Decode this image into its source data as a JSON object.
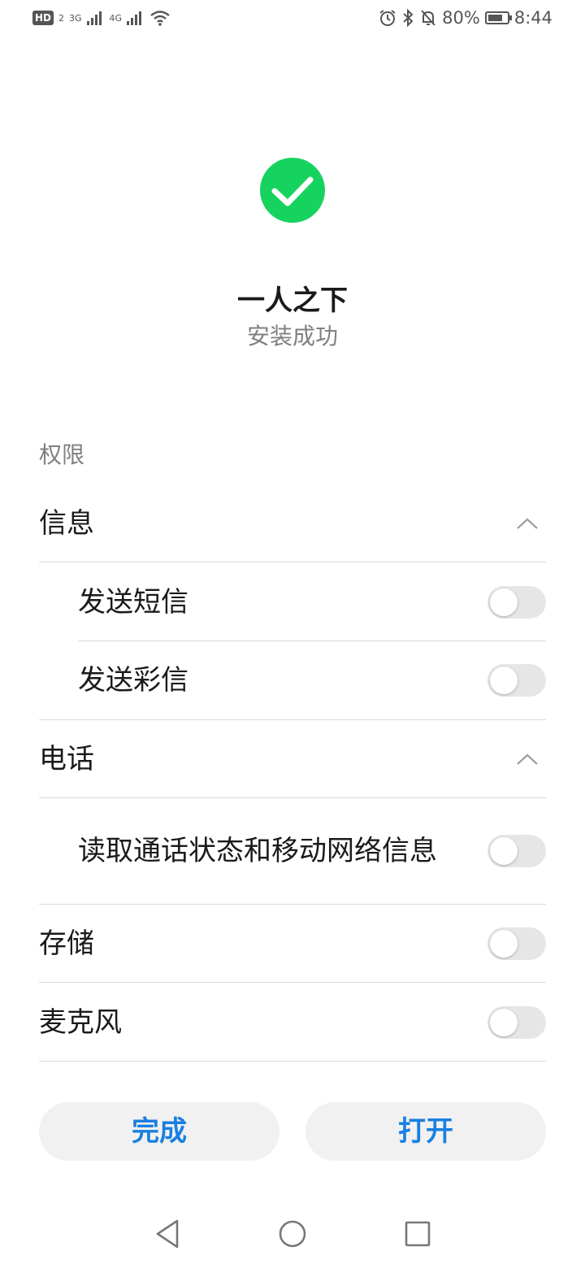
{
  "status_bar": {
    "hd": "HD",
    "hd_sub": "2",
    "signal1": "3G",
    "signal2": "4G",
    "battery_pct": "80%",
    "battery_level": 0.8,
    "time": "8:44",
    "icons": [
      "alarm-icon",
      "bluetooth-icon",
      "mute-icon",
      "wifi-icon"
    ]
  },
  "app": {
    "name": "一人之下",
    "status": "安装成功",
    "success_color": "#16d35f"
  },
  "permissions": {
    "header": "权限",
    "groups": [
      {
        "label": "信息",
        "expanded": true,
        "items": [
          {
            "label": "发送短信",
            "enabled": false
          },
          {
            "label": "发送彩信",
            "enabled": false
          }
        ]
      },
      {
        "label": "电话",
        "expanded": true,
        "items": [
          {
            "label": "读取通话状态和移动网络信息",
            "enabled": false
          }
        ]
      }
    ],
    "standalone": [
      {
        "label": "存储",
        "enabled": false
      },
      {
        "label": "麦克风",
        "enabled": false
      }
    ]
  },
  "actions": {
    "done_label": "完成",
    "open_label": "打开",
    "accent": "#1a7fe0"
  },
  "navbar": {
    "icons": [
      "back-icon",
      "home-icon",
      "recents-icon"
    ]
  }
}
